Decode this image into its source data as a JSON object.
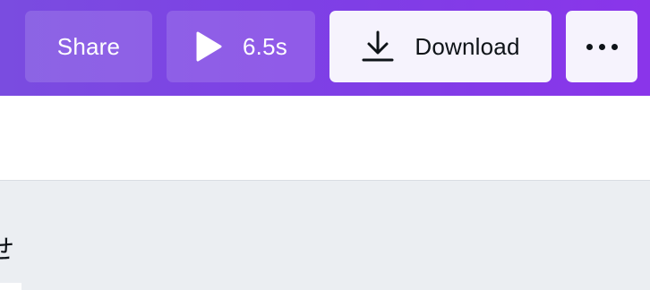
{
  "toolbar": {
    "share_label": "Share",
    "play_label": "6.5s",
    "download_label": "Download",
    "more_icon": "more-horizontal-icon",
    "play_icon": "play-icon",
    "download_icon": "download-icon"
  },
  "canvas": {
    "edge_text": "せ"
  },
  "colors": {
    "toolbar_bg_start": "#7a4ce0",
    "toolbar_bg_end": "#8a35ea",
    "light_button_bg": "#f6f3fd",
    "text_dark": "#0e1318",
    "canvas_bg": "#ebeef2"
  }
}
